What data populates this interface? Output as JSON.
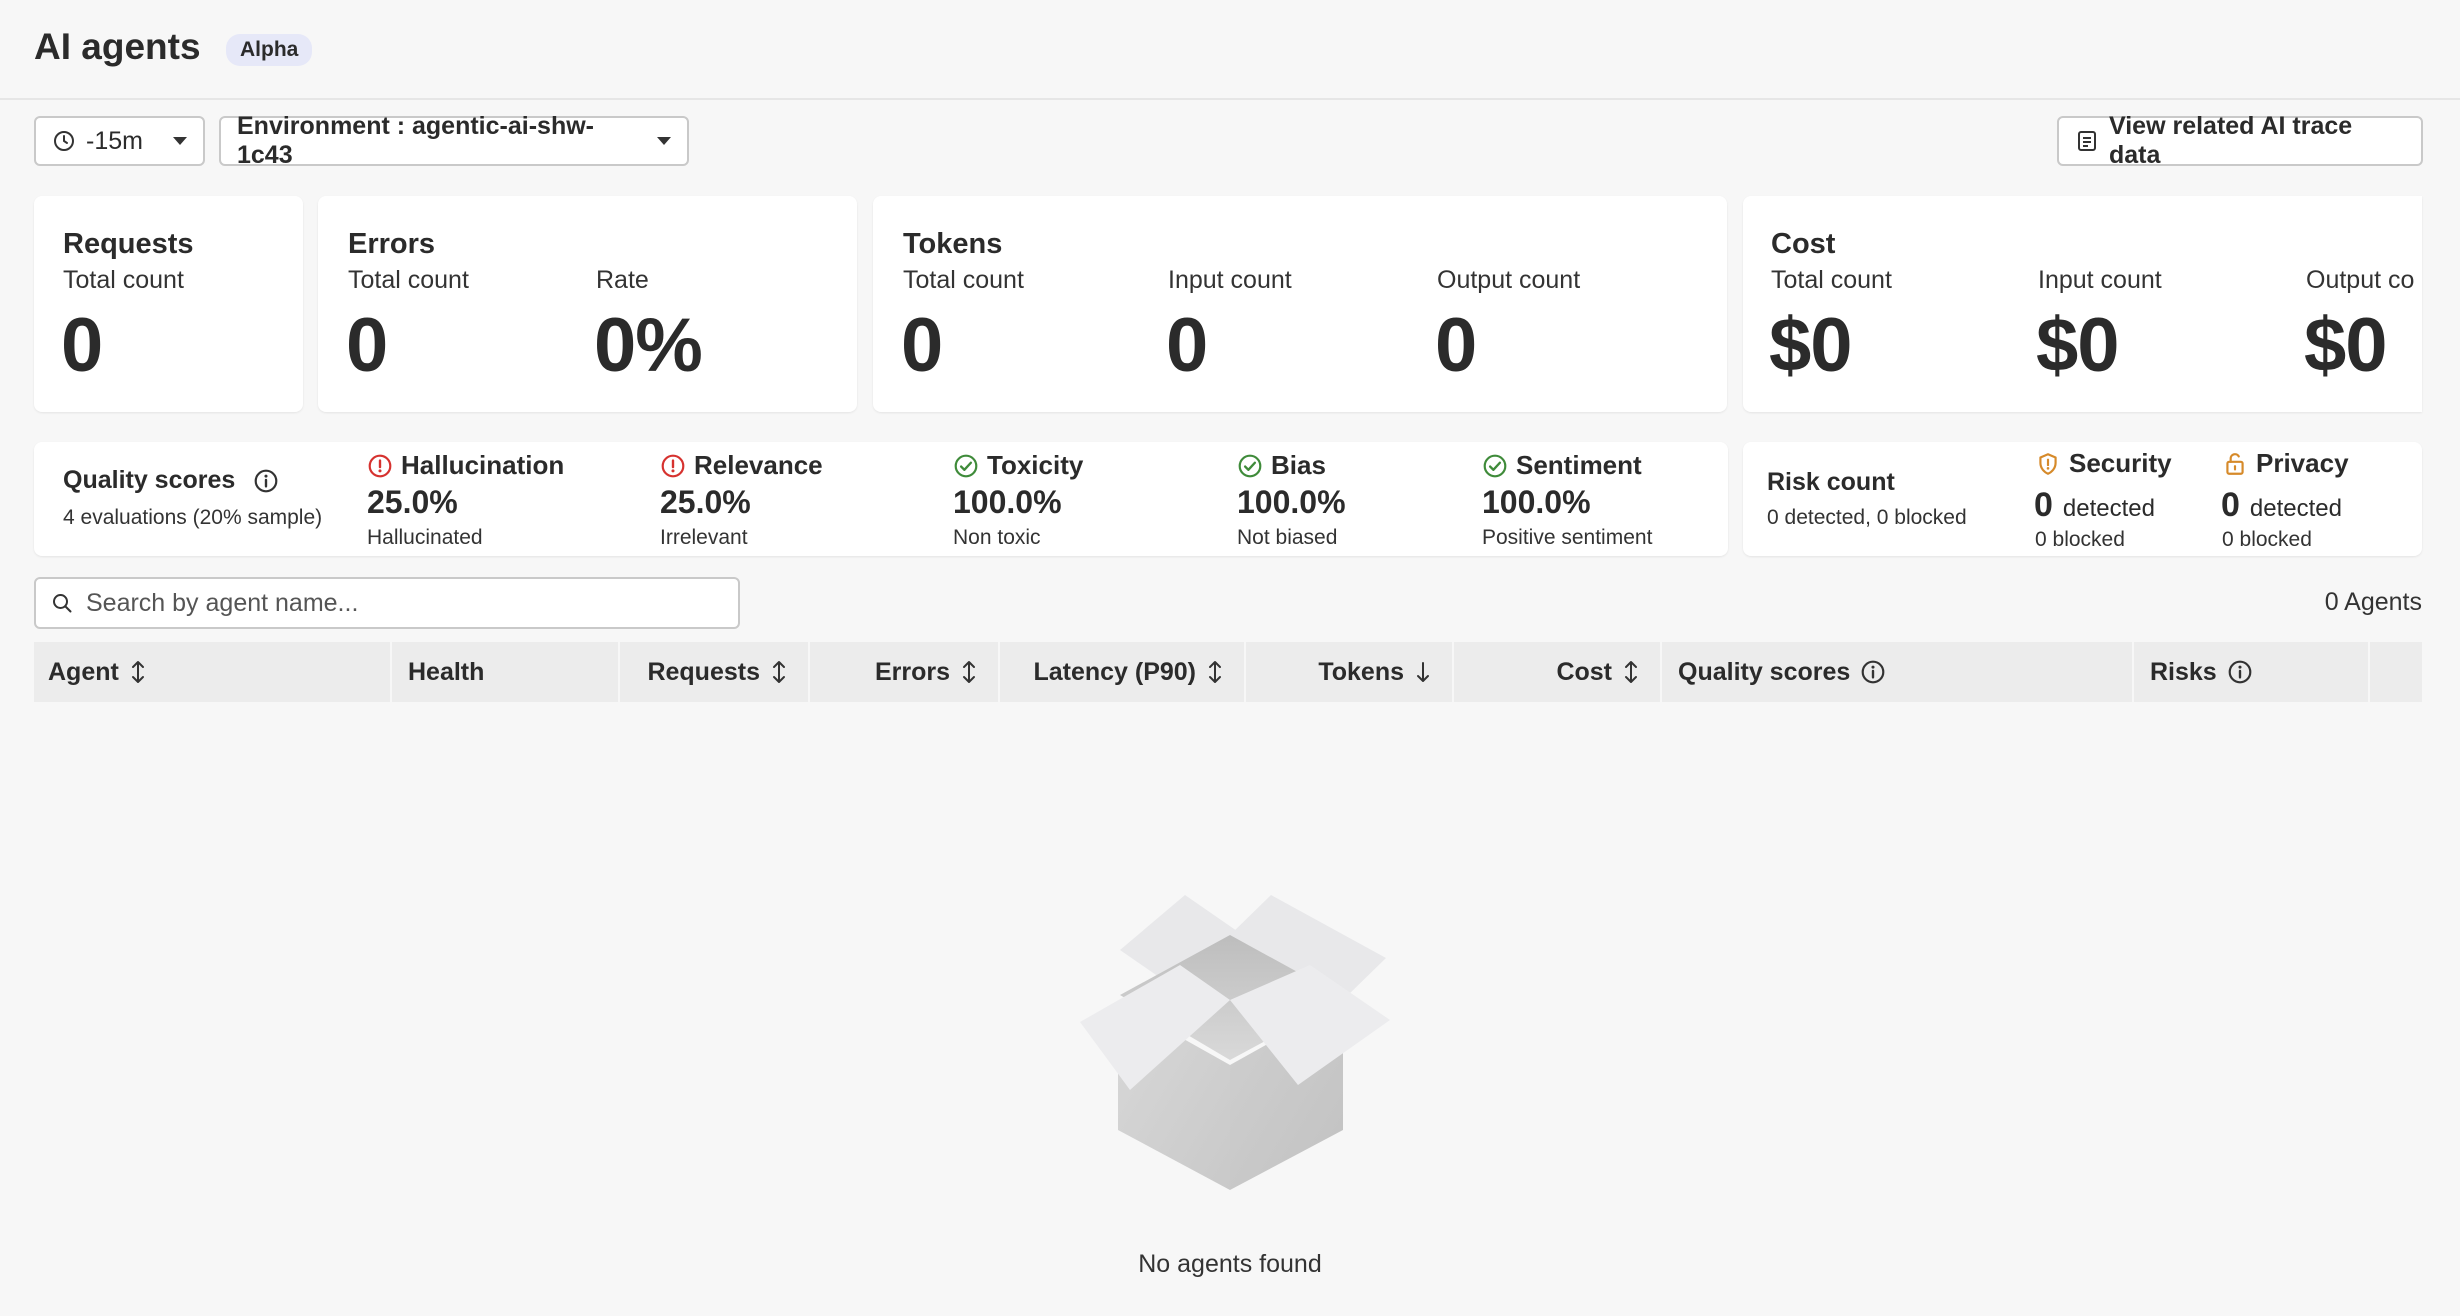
{
  "header": {
    "title": "AI agents",
    "badge": "Alpha"
  },
  "toolbar": {
    "time_range": "-15m",
    "environment": "Environment : agentic-ai-shw-1c43",
    "trace_button": "View related AI trace data"
  },
  "requests": {
    "title": "Requests",
    "total_label": "Total count",
    "total_value": "0"
  },
  "errors": {
    "title": "Errors",
    "total_label": "Total count",
    "total_value": "0",
    "rate_label": "Rate",
    "rate_value": "0%"
  },
  "tokens": {
    "title": "Tokens",
    "total_label": "Total count",
    "total_value": "0",
    "input_label": "Input count",
    "input_value": "0",
    "output_label": "Output count",
    "output_value": "0"
  },
  "cost": {
    "title": "Cost",
    "total_label": "Total count",
    "total_value": "$0",
    "input_label": "Input count",
    "input_value": "$0",
    "output_label": "Output co",
    "output_value": "$0"
  },
  "quality": {
    "title": "Quality scores",
    "subtitle": "4 evaluations (20% sample)",
    "items": [
      {
        "label": "Hallucination",
        "value": "25.0%",
        "sub": "Hallucinated",
        "status": "bad"
      },
      {
        "label": "Relevance",
        "value": "25.0%",
        "sub": "Irrelevant",
        "status": "bad"
      },
      {
        "label": "Toxicity",
        "value": "100.0%",
        "sub": "Non toxic",
        "status": "good"
      },
      {
        "label": "Bias",
        "value": "100.0%",
        "sub": "Not biased",
        "status": "good"
      },
      {
        "label": "Sentiment",
        "value": "100.0%",
        "sub": "Positive sentiment",
        "status": "good"
      }
    ]
  },
  "risk": {
    "title": "Risk count",
    "subtitle": "0 detected, 0 blocked",
    "security": {
      "label": "Security",
      "count": "0",
      "detected": "detected",
      "blocked": "0 blocked"
    },
    "privacy": {
      "label": "Privacy",
      "count": "0",
      "detected": "detected",
      "blocked": "0 blocked"
    }
  },
  "search": {
    "placeholder": "Search by agent name..."
  },
  "agent_count": "0 Agents",
  "table": {
    "columns": [
      "Agent",
      "Health",
      "Requests",
      "Errors",
      "Latency (P90)",
      "Tokens",
      "Cost",
      "Quality scores",
      "Risks"
    ]
  },
  "empty_state": "No agents found",
  "colors": {
    "bad": "#d6322f",
    "good": "#3f8b3a",
    "warning": "#d68a2a"
  }
}
